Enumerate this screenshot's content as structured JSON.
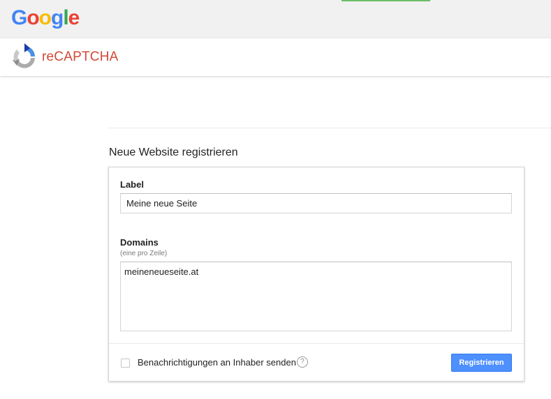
{
  "google_header": {
    "logo_letters": [
      "G",
      "o",
      "o",
      "g",
      "l",
      "e"
    ],
    "logo_colors": [
      "#4285F4",
      "#EA4335",
      "#FBBC05",
      "#4285F4",
      "#34A853",
      "#EA4335"
    ]
  },
  "app_header": {
    "title": "reCAPTCHA",
    "logo_icon": "recaptcha-logo-icon",
    "title_color": "#D14836"
  },
  "page": {
    "section_title": "Neue Website registrieren"
  },
  "form": {
    "label_field": {
      "label": "Label",
      "value": "Meine neue Seite"
    },
    "domains_field": {
      "label": "Domains",
      "hint": "(eine pro Zeile)",
      "value": "meineneueseite.at"
    },
    "notify_checkbox": {
      "label": "Benachrichtigungen an Inhaber senden",
      "checked": false,
      "help_icon": "help-icon",
      "help_symbol": "?"
    },
    "submit_label": "Registrieren",
    "accent_color": "#4D90FE"
  }
}
